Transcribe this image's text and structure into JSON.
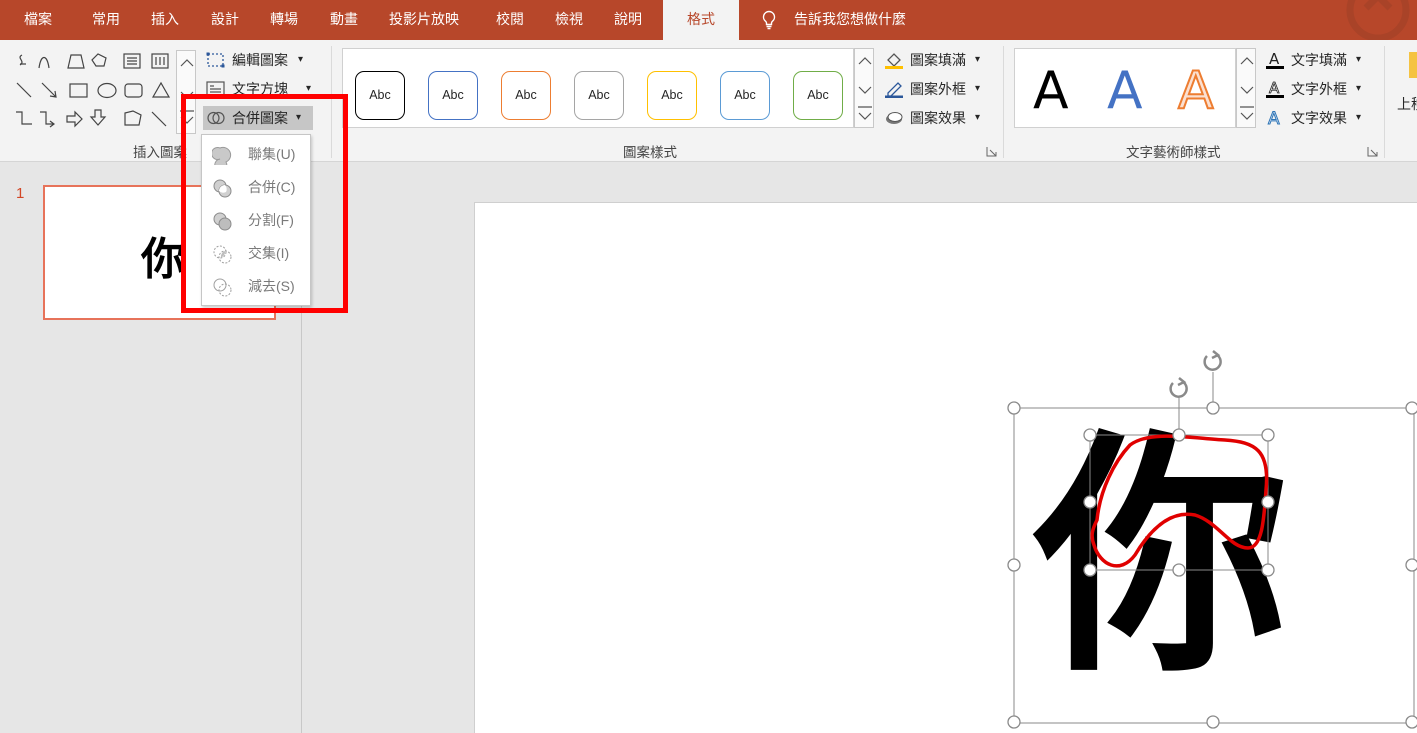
{
  "tabs": [
    {
      "label": "檔案",
      "active": false
    },
    {
      "label": "常用",
      "active": false
    },
    {
      "label": "插入",
      "active": false
    },
    {
      "label": "設計",
      "active": false
    },
    {
      "label": "轉場",
      "active": false
    },
    {
      "label": "動畫",
      "active": false
    },
    {
      "label": "投影片放映",
      "active": false
    },
    {
      "label": "校閱",
      "active": false
    },
    {
      "label": "檢視",
      "active": false
    },
    {
      "label": "說明",
      "active": false
    },
    {
      "label": "格式",
      "active": true
    }
  ],
  "tell_me": "告訴我您想做什麼",
  "ribbon": {
    "insert_shapes": {
      "label": "插入圖案",
      "edit_shape": "編輯圖案",
      "text_box": "文字方塊",
      "merge_shapes": "合併圖案"
    },
    "shape_styles": {
      "label": "圖案樣式",
      "sample_text": "Abc",
      "box_colors": [
        "#000000",
        "#4472c4",
        "#ed7d31",
        "#a5a5a5",
        "#ffc000",
        "#5b9bd5",
        "#70ad47"
      ],
      "shape_fill": "圖案填滿",
      "shape_outline": "圖案外框",
      "shape_effects": "圖案效果"
    },
    "wordart_styles": {
      "label": "文字藝術師樣式",
      "letters": [
        "A",
        "A",
        "A"
      ],
      "text_fill": "文字填滿",
      "text_outline": "文字外框",
      "text_effects": "文字效果"
    },
    "truncated_label": "上移"
  },
  "merge_menu": {
    "items": [
      {
        "label": "聯集(U)",
        "icon": "union-icon"
      },
      {
        "label": "合併(C)",
        "icon": "combine-icon"
      },
      {
        "label": "分割(F)",
        "icon": "fragment-icon"
      },
      {
        "label": "交集(I)",
        "icon": "intersect-icon"
      },
      {
        "label": "減去(S)",
        "icon": "subtract-icon"
      }
    ]
  },
  "slide_panel": {
    "slide_number": "1",
    "thumbnail_text": "你"
  },
  "slide": {
    "main_text": "你"
  },
  "colors": {
    "accent": "#b7472a",
    "highlight": "#ff0000",
    "selection_outline": "#e00000"
  }
}
